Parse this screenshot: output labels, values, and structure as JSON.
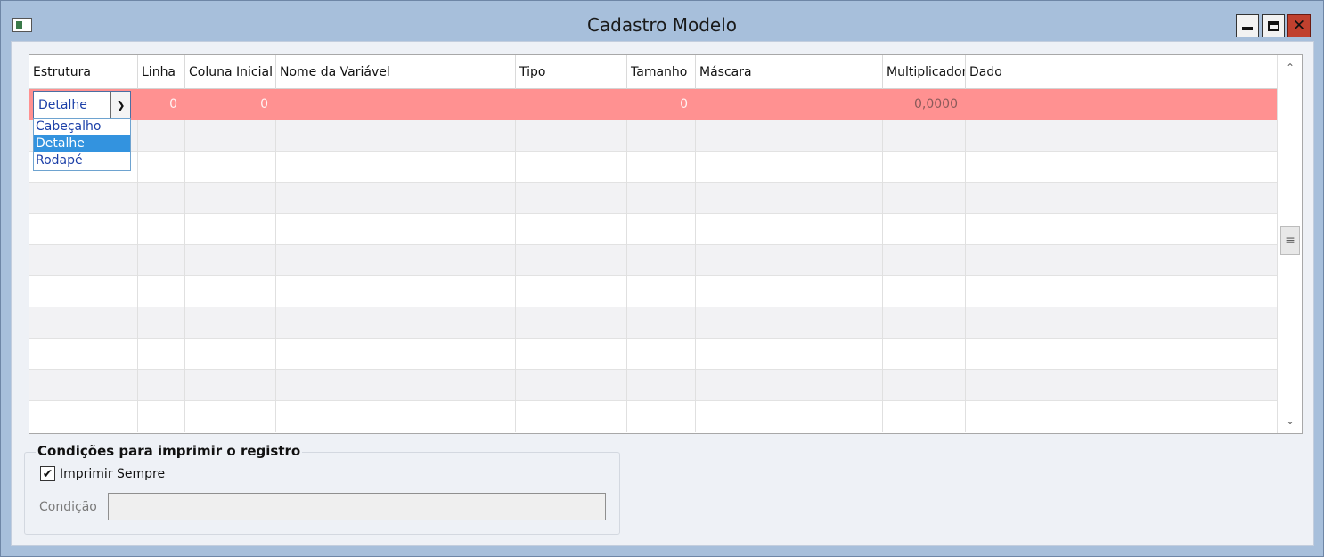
{
  "window": {
    "title": "Cadastro Modelo",
    "minimize_icon": "minimize-icon",
    "maximize_icon": "maximize-icon",
    "close_icon": "close-icon",
    "close_glyph": "✕"
  },
  "grid": {
    "columns": [
      {
        "label": "Estrutura"
      },
      {
        "label": "Linha"
      },
      {
        "label": "Coluna Inicial"
      },
      {
        "label": "Nome da Variável"
      },
      {
        "label": "Tipo"
      },
      {
        "label": "Tamanho"
      },
      {
        "label": "Máscara"
      },
      {
        "label": "Multiplicador"
      },
      {
        "label": "Dado"
      }
    ],
    "selected_row": {
      "estrutura": "Detalhe",
      "linha": "0",
      "coluna_inicial": "0",
      "nome_variavel": "",
      "tipo": "",
      "tamanho": "0",
      "mascara": "",
      "multiplicador": "0,0000",
      "dado": ""
    },
    "dropdown": {
      "options": [
        "Cabeçalho",
        "Detalhe",
        "Rodapé"
      ],
      "highlighted": "Detalhe"
    },
    "colors": {
      "selected_row": "#ff9191",
      "dropdown_highlight": "#3393df"
    }
  },
  "conditions": {
    "title": "Condições para imprimir o registro",
    "print_always_label": "Imprimir Sempre",
    "print_always_checked": true,
    "condition_label": "Condição",
    "condition_value": ""
  }
}
